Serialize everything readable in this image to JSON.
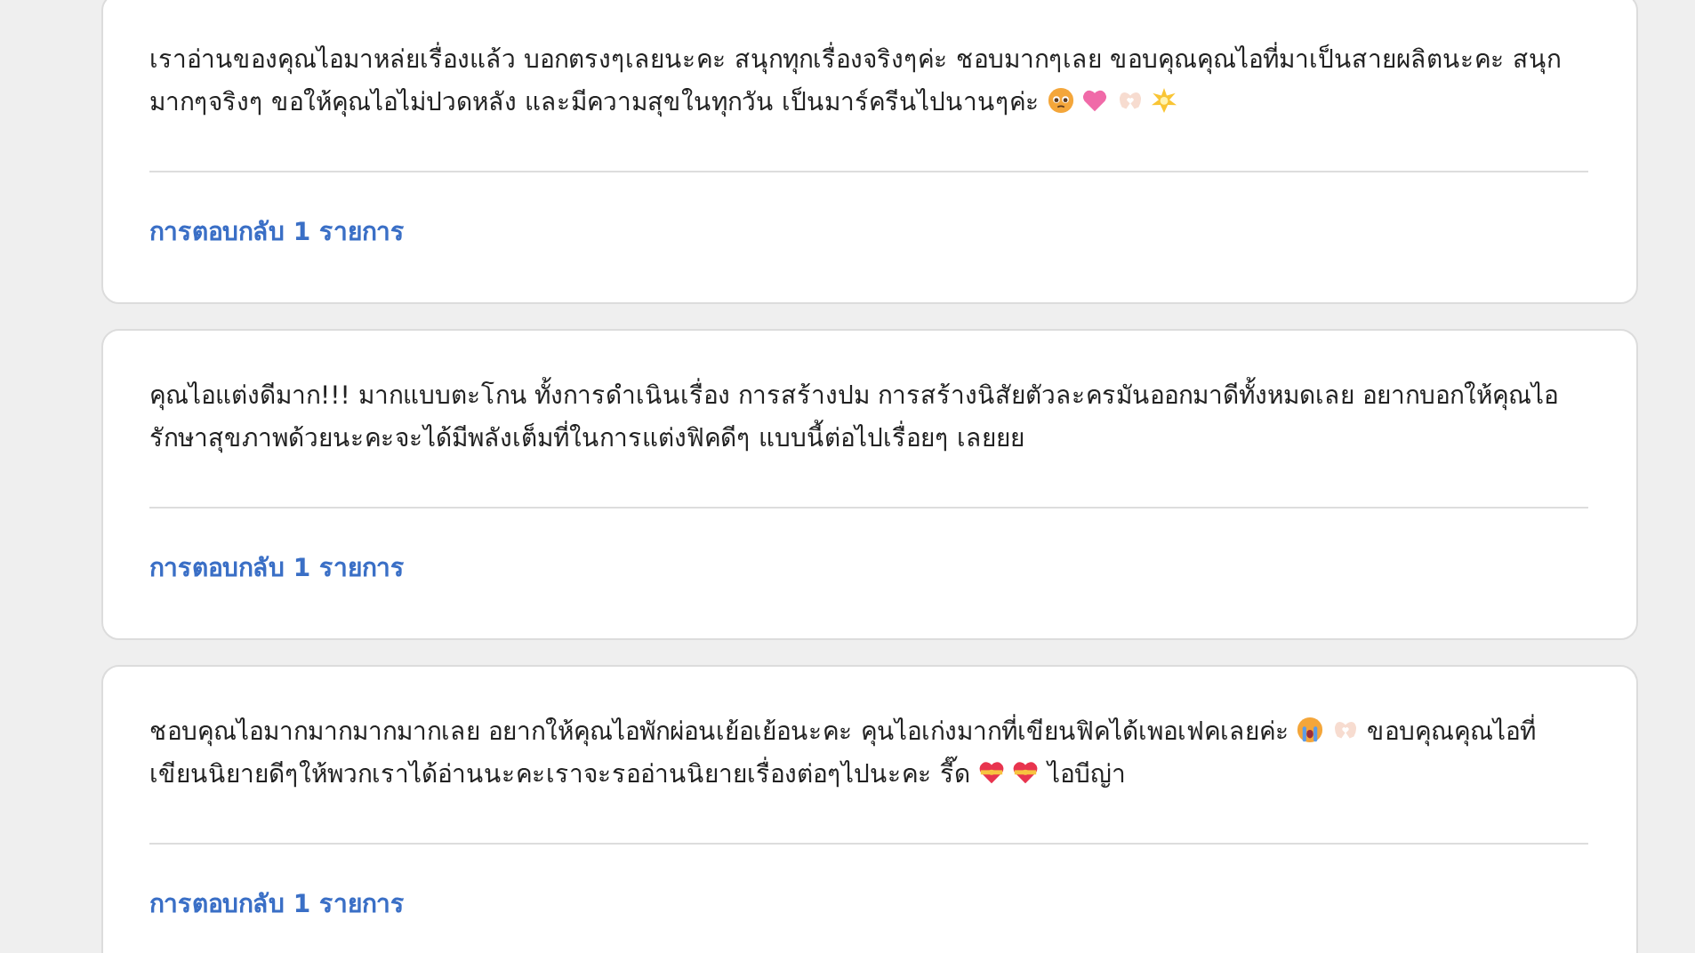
{
  "comments": [
    {
      "segments": [
        {
          "kind": "text",
          "text": "เราอ่านของคุณไอมาหล่ยเรื่องแล้ว บอกตรงๆเลยนะคะ สนุกทุกเรื่องจริงๆค่ะ ชอบมากๆเลย ขอบคุณคุณไอที่มาเป็นสายผลิตนะคะ สนุกมากๆจริงๆ ขอให้คุณไอไม่ปวดหลัง และมีความสุขในทุกวัน เป็นมาร์ครีนไปนานๆค่ะ"
        },
        {
          "kind": "pleading-face"
        },
        {
          "kind": "pink-heart"
        },
        {
          "kind": "heart-hands"
        },
        {
          "kind": "sparkle"
        }
      ],
      "replies": "การตอบกลับ 1 รายการ"
    },
    {
      "segments": [
        {
          "kind": "text",
          "text": "คุณไอแต่งดีมาก!!! มากแบบตะโกน ทั้งการดำเนินเรื่อง การสร้างปม การสร้างนิสัยตัวละครมันออกมาดีทั้งหมดเลย อยากบอกให้คุณไอรักษาสุขภาพด้วยนะคะจะได้มีพลังเต็มที่ในการแต่งฟิคดีๆ แบบนี้ต่อไปเรื่อยๆ เลยยย"
        }
      ],
      "replies": "การตอบกลับ 1 รายการ"
    },
    {
      "segments": [
        {
          "kind": "text",
          "text": "ชอบคุณไอมากมากมากมากเลย อยากให้คุณไอพักผ่อนเย้อเย้อนะคะ คุนไอเก่งมากที่เขียนฟิคได้เพอเฟคเลยค่ะ"
        },
        {
          "kind": "crying-face"
        },
        {
          "kind": "heart-hands"
        },
        {
          "kind": "text",
          "text": "ขอบคุณคุณไอที่เขียนนิยายดีๆให้พวกเราได้อ่านนะคะเราจะรออ่านนิยายเรื่องต่อๆไปนะคะ รี๊ด"
        },
        {
          "kind": "ribbon-heart"
        },
        {
          "kind": "ribbon-heart"
        },
        {
          "kind": "text",
          "text": "ไอบีญ่า"
        }
      ],
      "replies": "การตอบกลับ 1 รายการ"
    }
  ]
}
